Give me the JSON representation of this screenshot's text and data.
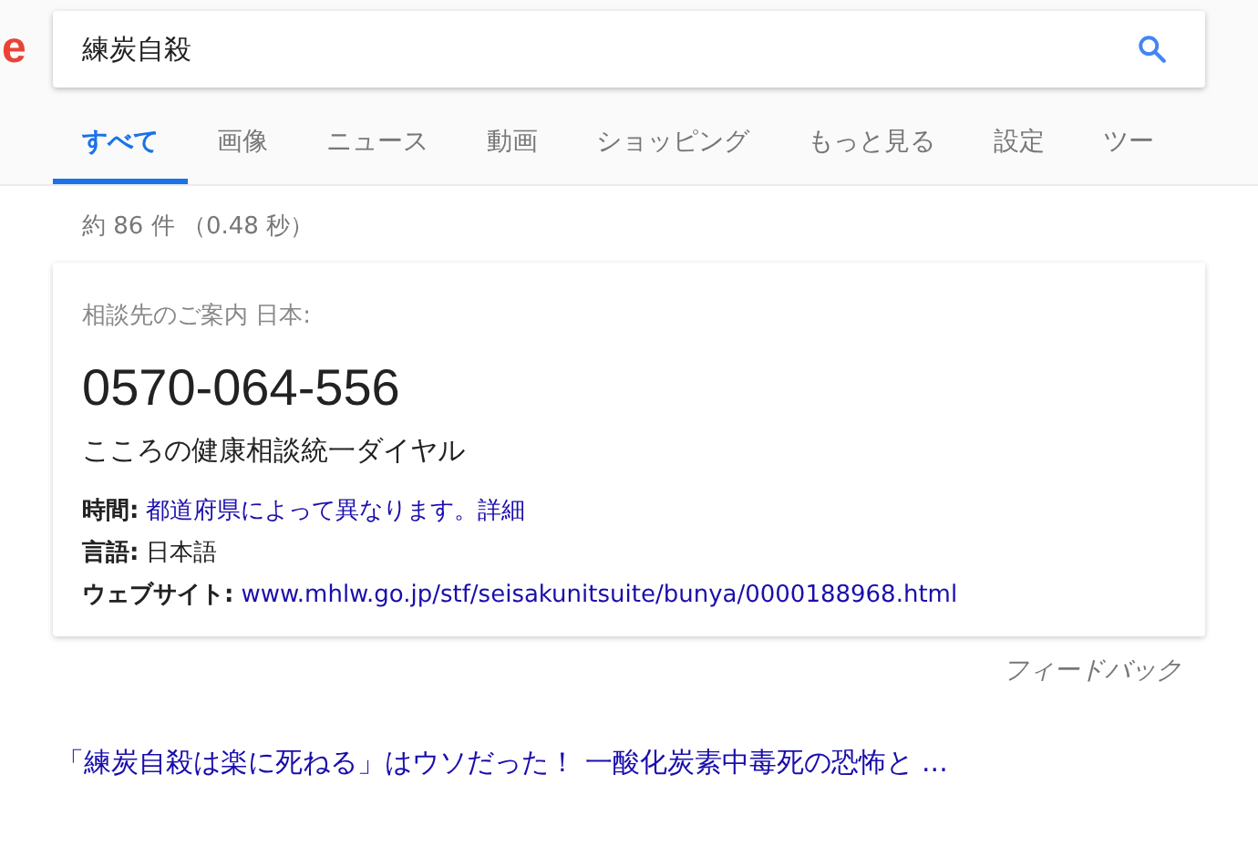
{
  "logo_fragment": "e",
  "search": {
    "value": "練炭自殺"
  },
  "tabs": [
    {
      "label": "すべて",
      "selected": true
    },
    {
      "label": "画像",
      "selected": false
    },
    {
      "label": "ニュース",
      "selected": false
    },
    {
      "label": "動画",
      "selected": false
    },
    {
      "label": "ショッピング",
      "selected": false
    },
    {
      "label": "もっと見る",
      "selected": false
    },
    {
      "label": "設定",
      "selected": false
    },
    {
      "label": "ツー",
      "selected": false
    }
  ],
  "result_stats": "約 86 件 （0.48 秒）",
  "helpline_card": {
    "heading": "相談先のご案内 日本:",
    "phone": "0570-064-556",
    "name": "こころの健康相談統一ダイヤル",
    "details": [
      {
        "label": "時間:",
        "value": "都道府県によって異なります。詳細",
        "kind": "link"
      },
      {
        "label": "言語:",
        "value": "日本語",
        "kind": "text"
      },
      {
        "label": "ウェブサイト:",
        "value": "www.mhlw.go.jp/stf/seisakunitsuite/bunya/0000188968.html",
        "kind": "link"
      }
    ]
  },
  "feedback": "フィードバック",
  "results": [
    {
      "title": "「練炭自殺は楽に死ねる」はウソだった！ 一酸化炭素中毒死の恐怖と ..."
    }
  ]
}
